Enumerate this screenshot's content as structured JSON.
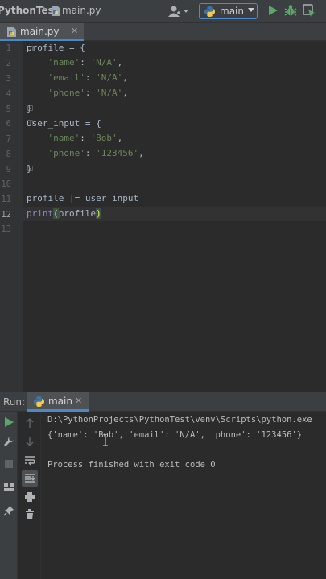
{
  "navbar": {
    "project": "PythonTest",
    "file": "main.py",
    "run_config": "main",
    "icons": [
      "user-icon",
      "python-icon",
      "run-icon",
      "debug-icon",
      "coverage-icon"
    ]
  },
  "editor_tab": {
    "label": "main.py",
    "close": "✕"
  },
  "editor": {
    "line_numbers": [
      "1",
      "2",
      "3",
      "4",
      "5",
      "6",
      "7",
      "8",
      "9",
      "10",
      "11",
      "12",
      "13"
    ],
    "current_line": 12
  },
  "run_panel": {
    "title": "Run:",
    "tab_label": "main",
    "tab_close": "✕",
    "console": [
      "D:\\PythonProjects\\PythonTest\\venv\\Scripts\\python.exe",
      "{'name': 'Bob', 'email': 'N/A', 'phone': '123456'}",
      "",
      "Process finished with exit code 0"
    ]
  },
  "colors": {
    "string": "#6a8759",
    "builtin": "#8888c6",
    "text": "#a9b7c6",
    "accent": "#4a88c7",
    "run_green": "#59a869"
  }
}
